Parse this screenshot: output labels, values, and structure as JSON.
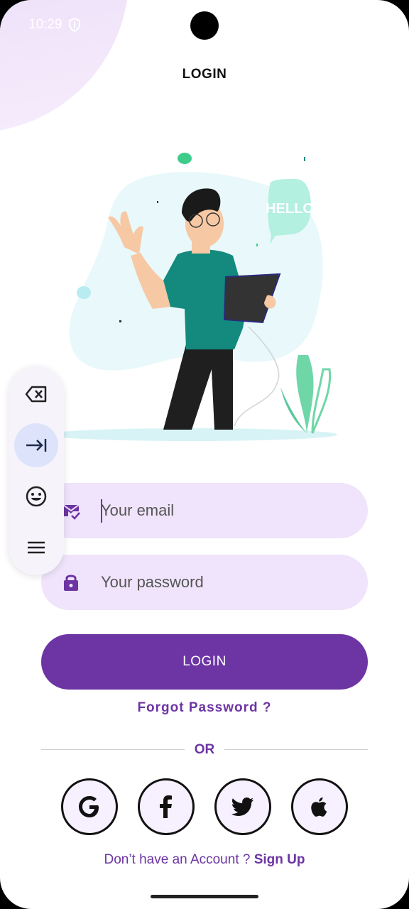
{
  "status_bar": {
    "time": "10:29",
    "icon": "shield-icon"
  },
  "page": {
    "title": "LOGIN"
  },
  "form": {
    "email_placeholder": "Your email",
    "email_value": "",
    "email_icon": "mail-check-icon",
    "password_placeholder": "Your password",
    "password_value": "",
    "password_icon": "lock-icon",
    "login_label": "LOGIN",
    "forgot_label": "Forgot Password ?"
  },
  "divider": {
    "label": "OR"
  },
  "social": [
    {
      "name": "google",
      "icon": "google-icon"
    },
    {
      "name": "facebook",
      "icon": "facebook-icon"
    },
    {
      "name": "twitter",
      "icon": "twitter-icon"
    },
    {
      "name": "apple",
      "icon": "apple-icon"
    }
  ],
  "signup": {
    "prompt": "Don’t have an Account ? ",
    "link": "Sign Up"
  },
  "illustration": {
    "bubble_text": "HELLO"
  },
  "keyboard_toolbar": {
    "items": [
      "backspace-icon",
      "tab-icon",
      "emoji-icon",
      "menu-icon"
    ],
    "active": "tab-icon"
  },
  "colors": {
    "accent": "#6c35a3",
    "input_bg": "#efe4fb",
    "shirt": "#138a7d"
  }
}
